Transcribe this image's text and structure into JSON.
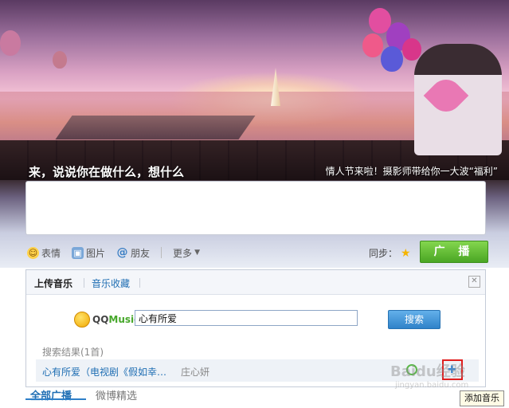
{
  "banner": {
    "prompt": "来，说说你在做什么，想什么",
    "promo": "情人节来啦！摄影师带给你一大波“福利”"
  },
  "composer": {
    "textarea_value": "",
    "tools": {
      "emoji": "表情",
      "picture": "图片",
      "friends": "朋友",
      "more": "更多"
    },
    "sync_label": "同步：",
    "broadcast_label": "广 播"
  },
  "music_panel": {
    "tabs": [
      "上传音乐",
      "音乐收藏"
    ],
    "active_tab": "上传音乐",
    "logo": {
      "qq": "QQ",
      "music": "Music"
    },
    "search_value": "心有所爱",
    "search_button": "搜索",
    "result_count": "搜索结果(1首)",
    "results": [
      {
        "title": "心有所爱（电视剧《假如幸…",
        "artist": "庄心妍"
      }
    ]
  },
  "tooltip": "添加音乐",
  "bottom_tabs": [
    "全部广播",
    "微博精选"
  ],
  "watermark": "Baidu经验",
  "watermark_url": "jingyan.baidu.com",
  "colors": {
    "accent_blue": "#1f6eb3",
    "broadcast_green": "#4aa624",
    "highlight_red": "#e02020"
  },
  "icons": {
    "emoji": "smiley-icon",
    "picture": "picture-icon",
    "friends": "at-icon",
    "more": "chevron-down-icon",
    "sync": "star-icon",
    "close": "close-icon",
    "play": "play-icon",
    "add": "add-music-icon"
  }
}
